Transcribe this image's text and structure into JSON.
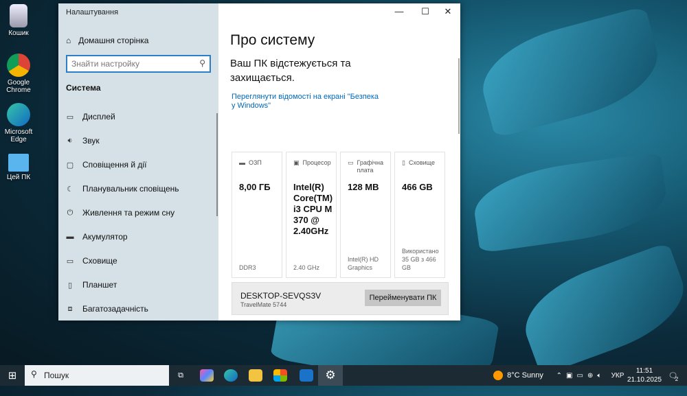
{
  "desktop": {
    "icons": [
      "Кошик",
      "Google Chrome",
      "Microsoft Edge",
      "Цей ПК"
    ]
  },
  "window": {
    "title": "Налаштування",
    "home": "Домашня сторінка",
    "search_placeholder": "Знайти настройку",
    "section": "Система",
    "nav": [
      {
        "label": "Дисплей",
        "icon": "display-icon"
      },
      {
        "label": "Звук",
        "icon": "sound-icon"
      },
      {
        "label": "Сповіщення й дії",
        "icon": "notifications-icon"
      },
      {
        "label": "Планувальник сповіщень",
        "icon": "moon-icon"
      },
      {
        "label": "Живлення та режим сну",
        "icon": "power-icon"
      },
      {
        "label": "Акумулятор",
        "icon": "battery-icon"
      },
      {
        "label": "Сховище",
        "icon": "storage-icon"
      },
      {
        "label": "Планшет",
        "icon": "tablet-icon"
      },
      {
        "label": "Багатозадачність",
        "icon": "multitask-icon"
      }
    ]
  },
  "main": {
    "title": "Про систему",
    "protection": "Ваш ПК відстежується та захищається.",
    "security_link": "Переглянути відомості на екрані \"Безпека у Windows\"",
    "cards": [
      {
        "label": "ОЗП",
        "value": "8,00 ГБ",
        "sub": "DDR3"
      },
      {
        "label": "Процесор",
        "value": "Intel(R) Core(TM) i3 CPU M 370  @ 2.40GHz",
        "sub": "2.40 GHz"
      },
      {
        "label": "Графічна плата",
        "value": "128 MB",
        "sub": "Intel(R) HD Graphics"
      },
      {
        "label": "Сховище",
        "value": "466 GB",
        "sub": "Використано 35 GB з 466 GB"
      }
    ],
    "pc_name": "DESKTOP-SEVQS3V",
    "pc_model": "TravelMate 5744",
    "rename": "Перейменувати ПК"
  },
  "taskbar": {
    "search": "Пошук",
    "weather": "8°C  Sunny",
    "lang": "УКР",
    "time": "11:51",
    "date": "21.10.2025",
    "notif_count": "2"
  }
}
